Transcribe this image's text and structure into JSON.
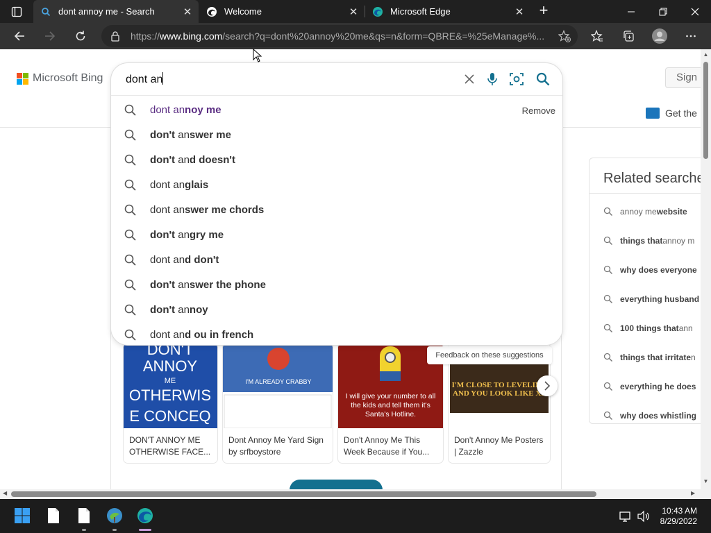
{
  "tabs": [
    {
      "title": "dont annoy me - Search",
      "icon": "bing-search-icon"
    },
    {
      "title": "Welcome",
      "icon": "edge-alt-icon"
    },
    {
      "title": "Microsoft Edge",
      "icon": "edge-icon"
    }
  ],
  "address": {
    "prefix": "https://",
    "host": "www.bing.com",
    "path": "/search?q=dont%20annoy%20me&qs=n&form=QBRE&=%25eManage%..."
  },
  "bing": {
    "brand": "Microsoft Bing",
    "sign_in": "Sign i",
    "get_the": "Get the",
    "query": "dont an",
    "remove": "Remove",
    "feedback": "Feedback on these suggestions"
  },
  "suggestions": [
    {
      "plain": "dont an",
      "bold": "noy me",
      "history": true
    },
    {
      "pre": "don't",
      "plain": " an",
      "bold": "swer me"
    },
    {
      "pre": "don't",
      "plain": " an",
      "bold": "d doesn't"
    },
    {
      "plain": "dont an",
      "bold": "glais"
    },
    {
      "plain": "dont an",
      "bold": "swer me chords"
    },
    {
      "pre": "don't",
      "plain": " an",
      "bold": "gry me"
    },
    {
      "plain": "dont an",
      "bold": "d don't"
    },
    {
      "pre": "don't",
      "plain": " an",
      "bold": "swer the phone"
    },
    {
      "pre": "don't",
      "plain": " an",
      "bold": "noy"
    },
    {
      "plain": "dont an",
      "bold": "d ou in french"
    }
  ],
  "related": {
    "title": "Related searche",
    "items": [
      {
        "plain": "annoy me ",
        "bold": "website",
        "boldFirst": false
      },
      {
        "bold": "things that",
        "plain": " annoy m",
        "boldFirst": true
      },
      {
        "bold": "why does everyone",
        "plain": "",
        "boldFirst": true
      },
      {
        "bold": "everything husband",
        "plain": "",
        "boldFirst": true
      },
      {
        "bold": "100 things that",
        "plain": " ann",
        "boldFirst": true
      },
      {
        "bold": "things that irritate",
        "plain": " n",
        "boldFirst": true
      },
      {
        "bold": "everything he does",
        "plain": "",
        "boldFirst": true
      },
      {
        "bold": "why does whistling",
        "plain": "",
        "boldFirst": true
      }
    ]
  },
  "cards": [
    {
      "caption": "DON'T ANNOY ME OTHERWISE FACE...",
      "img_lines": [
        "DON'T",
        "ANNOY",
        "ME",
        "OTHERWIS",
        "E CONCEQ"
      ]
    },
    {
      "caption": "Dont Annoy Me Yard Sign by srfboystore",
      "img_text": "I'M ALREADY CRABBY"
    },
    {
      "caption": "Don't Annoy Me This Week Because if You...",
      "img_text": "I will give your number to all the kids and tell them it's Santa's Hotline."
    },
    {
      "caption": "Don't Annoy Me Posters | Zazzle",
      "img_text": "I'M CLOSE TO LEVELING AND YOU LOOK LIKE XP"
    }
  ],
  "clock": {
    "time": "10:43 AM",
    "date": "8/29/2022"
  },
  "colors": {
    "bing_blue": "#13708f",
    "history_purple": "#5a2d82",
    "tab_bar": "#202020",
    "toolbar": "#333333"
  }
}
